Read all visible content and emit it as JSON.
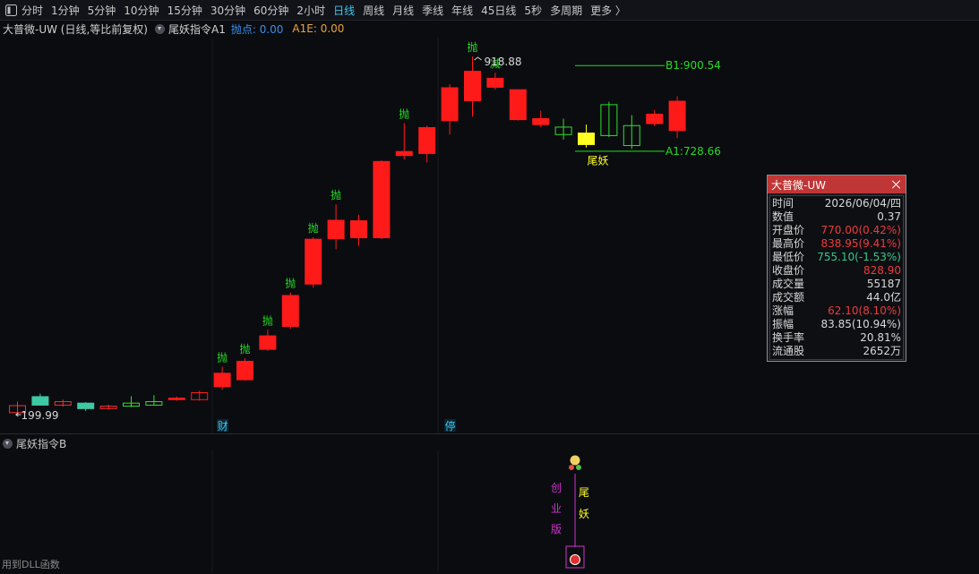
{
  "toolbar": {
    "items": [
      "分时",
      "1分钟",
      "5分钟",
      "10分钟",
      "15分钟",
      "30分钟",
      "60分钟",
      "2小时",
      "日线",
      "周线",
      "月线",
      "季线",
      "年线",
      "45日线",
      "5秒",
      "多周期",
      "更多 〉"
    ],
    "active_index": 8
  },
  "header": {
    "symbol_title": "大普微-UW (日线,等比前复权)",
    "indicator_name": "尾妖指令A1",
    "throw_point": "抛点: 0.00",
    "a1e": "A1E: 0.00"
  },
  "main_chart": {
    "candles": [
      {
        "o": 218,
        "c": 204,
        "h": 226,
        "l": 199.99
      },
      {
        "o": 219,
        "c": 236,
        "h": 242,
        "l": 218
      },
      {
        "o": 219,
        "c": 226,
        "h": 230,
        "l": 216
      },
      {
        "o": 223,
        "c": 212,
        "h": 225,
        "l": 207
      },
      {
        "o": 212,
        "c": 217,
        "h": 220,
        "l": 210
      },
      {
        "o": 217,
        "c": 223,
        "h": 237,
        "l": 215
      },
      {
        "o": 219,
        "c": 226,
        "h": 239,
        "l": 218
      },
      {
        "o": 230,
        "c": 233,
        "h": 236,
        "l": 228
      },
      {
        "o": 230,
        "c": 244,
        "h": 248,
        "l": 228
      },
      {
        "o": 256,
        "c": 283,
        "h": 296,
        "l": 250
      },
      {
        "o": 270,
        "c": 307,
        "h": 313,
        "l": 268
      },
      {
        "o": 331,
        "c": 358,
        "h": 370,
        "l": 328
      },
      {
        "o": 377,
        "c": 439,
        "h": 445,
        "l": 372
      },
      {
        "o": 462,
        "c": 552,
        "h": 556,
        "l": 455
      },
      {
        "o": 553,
        "c": 590,
        "h": 622,
        "l": 532
      },
      {
        "o": 589,
        "c": 555,
        "h": 601,
        "l": 538
      },
      {
        "o": 555,
        "c": 708,
        "h": 710,
        "l": 552
      },
      {
        "o": 720,
        "c": 728,
        "h": 785,
        "l": 712
      },
      {
        "o": 724,
        "c": 776,
        "h": 780,
        "l": 706
      },
      {
        "o": 790,
        "c": 856,
        "h": 863,
        "l": 762
      },
      {
        "o": 830,
        "c": 889,
        "h": 918.88,
        "l": 798
      },
      {
        "o": 875,
        "c": 857,
        "h": 886,
        "l": 852
      },
      {
        "o": 852,
        "c": 792,
        "h": 853,
        "l": 790
      },
      {
        "o": 794,
        "c": 782,
        "h": 810,
        "l": 777
      },
      {
        "o": 777,
        "c": 762,
        "h": 794,
        "l": 752
      },
      {
        "o": 765,
        "c": 742,
        "h": 782,
        "l": 736
      },
      {
        "o": 760,
        "c": 822,
        "h": 828,
        "l": 757
      },
      {
        "o": 780,
        "c": 740,
        "h": 801,
        "l": 733
      },
      {
        "o": 784,
        "c": 803,
        "h": 811,
        "l": 779
      },
      {
        "o": 770.0,
        "c": 828.9,
        "h": 838.95,
        "l": 755.1
      }
    ],
    "signals": [
      {
        "i": 9,
        "text": "抛"
      },
      {
        "i": 10,
        "text": "抛"
      },
      {
        "i": 11,
        "text": "抛"
      },
      {
        "i": 12,
        "text": "抛"
      },
      {
        "i": 13,
        "text": "抛"
      },
      {
        "i": 14,
        "text": "抛"
      },
      {
        "i": 17,
        "text": "抛"
      },
      {
        "i": 20,
        "text": "抛"
      },
      {
        "i": 21,
        "text": "减"
      }
    ],
    "high_label": "918.88",
    "low_label": "199.99",
    "b1_label": "B1:900.54",
    "a1_label": "A1:728.66",
    "yaoyao_label": "尾妖",
    "markers": [
      {
        "i": 9,
        "text": "财"
      },
      {
        "i": 19,
        "text": "停"
      }
    ]
  },
  "sub_chart": {
    "title": "尾妖指令B",
    "board_label": [
      "创",
      "业",
      "版"
    ],
    "tail_label": [
      "尾",
      "妖"
    ]
  },
  "status_bar": {
    "text": "用到DLL函数"
  },
  "info_panel": {
    "title": "大普微-UW",
    "rows": [
      {
        "k": "时间",
        "v": "2026/06/04/四",
        "style": ""
      },
      {
        "k": "数值",
        "v": "0.37",
        "style": ""
      },
      {
        "k": "开盘价",
        "v": "770.00(0.42%)",
        "style": "red"
      },
      {
        "k": "最高价",
        "v": "838.95(9.41%)",
        "style": "red"
      },
      {
        "k": "最低价",
        "v": "755.10(-1.53%)",
        "style": "green"
      },
      {
        "k": "收盘价",
        "v": "828.90",
        "style": "red"
      },
      {
        "k": "成交量",
        "v": "55187",
        "style": ""
      },
      {
        "k": "成交额",
        "v": "44.0亿",
        "style": ""
      },
      {
        "k": "涨幅",
        "v": "62.10(8.10%)",
        "style": "red"
      },
      {
        "k": "振幅",
        "v": "83.85(10.94%)",
        "style": ""
      },
      {
        "k": "换手率",
        "v": "20.81%",
        "style": ""
      },
      {
        "k": "流通股",
        "v": "2652万",
        "style": ""
      }
    ]
  },
  "colors": {
    "up": "#ff1a1a",
    "down": "#3ec9a5",
    "signal": "#22dd22",
    "highlight": "#ffff22",
    "accent": "#3ec7f0"
  }
}
